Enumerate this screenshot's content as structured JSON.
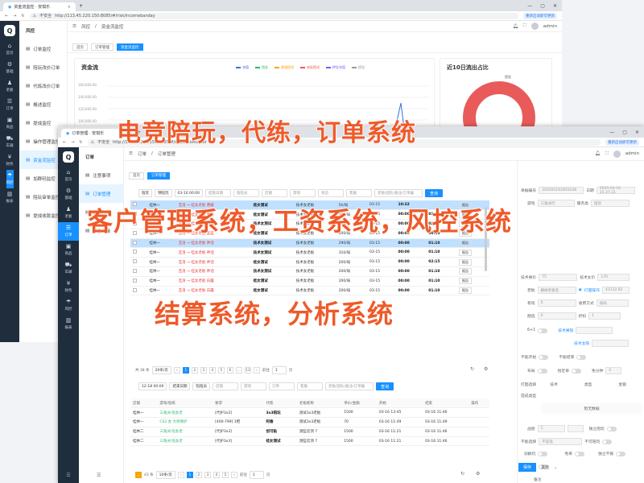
{
  "bg_window": {
    "tab_title": "资金流监控 · 安琪乐",
    "not_secure": "不安全",
    "url": "http://113.45.220.150:8085/#/risk/incomebanday",
    "update_label": "重新启动即可更新",
    "sidebar": [
      {
        "icon": "home-icon",
        "label": "首页"
      },
      {
        "icon": "base-icon",
        "label": "基础"
      },
      {
        "icon": "boss-icon",
        "label": "老板"
      },
      {
        "icon": "order-icon",
        "label": "订单"
      },
      {
        "icon": "shop-icon",
        "label": "商品"
      },
      {
        "icon": "car-icon",
        "label": "车辆"
      },
      {
        "icon": "finance-icon",
        "label": "财务"
      },
      {
        "icon": "risk-icon",
        "label": "风控"
      },
      {
        "icon": "report-icon",
        "label": "报表"
      }
    ],
    "submenu_title": "风控",
    "submenu": [
      "订单监控",
      "陪玩改价订单",
      "代练改价订单",
      "概述监控",
      "提成监控",
      "操作管理监控",
      "资金流监控",
      "加群码监控",
      "陪玩审单监控",
      "提成收款监控"
    ],
    "breadcrumb": [
      "风控",
      "资金流监控"
    ],
    "tags": [
      "首页",
      "订单管理",
      "资金流监控"
    ],
    "card1_title": "资金流",
    "legend": [
      "充值",
      "佣金",
      "客服提成",
      "老板提成",
      "押金充值",
      "提现"
    ],
    "card2_title": "近10日流出占比",
    "donut_label": "提现",
    "user": "admin",
    "y_axis": [
      "160,000.00",
      "140,000.00",
      "120,000.00",
      "100,000.00"
    ]
  },
  "fg_window": {
    "tab_title": "订单管理 · 安琪乐",
    "not_secure": "不安全",
    "url": "http://113.45.220.150:8085/#/ord/accomorder",
    "update_label": "重新启动即可更新",
    "sidebar": [
      {
        "icon": "home-icon",
        "label": "首页"
      },
      {
        "icon": "base-icon",
        "label": "基础"
      },
      {
        "icon": "boss-icon",
        "label": "老板"
      },
      {
        "icon": "order-icon",
        "label": "订单"
      },
      {
        "icon": "shop-icon",
        "label": "商品"
      },
      {
        "icon": "car-icon",
        "label": "车辆"
      },
      {
        "icon": "finance-icon",
        "label": "财务"
      },
      {
        "icon": "risk-icon",
        "label": "风控"
      },
      {
        "icon": "report-icon",
        "label": "报表"
      }
    ],
    "submenu_title": "订单",
    "submenu": [
      "注意事项",
      "订单管理",
      "订单",
      "报备记录"
    ],
    "breadcrumb": [
      "订单",
      "订单管理"
    ],
    "tags": [
      "首页",
      "订单管理"
    ],
    "user": "admin",
    "filters1": [
      "陪玩",
      "预陪玩",
      "03-10 00:00",
      "结束日期",
      "陪陪员",
      "店铺",
      "游戏",
      "状态",
      "客服",
      "老板/团队/备注/订单编",
      "查询"
    ],
    "table1_rows": [
      {
        "a": "桂林一",
        "b": "瓦洛 → 桂女老板 曹媛",
        "c": "桂女测试",
        "d": "技术女老板",
        "e": "5h/局",
        "f": "03-15",
        "g": "10:32",
        "h": "",
        "i": "报告",
        "sel": true
      },
      {
        "a": "桂林一",
        "b": "瓦洛 → 桂女老板 曹媛",
        "c": "桂女测试",
        "d": "技术女老板",
        "e": "310/局",
        "f": "03-15",
        "g": "00:00",
        "h": "01:10",
        "i": "报告",
        "sel": false
      },
      {
        "a": "桂林一",
        "b": "瓦洛 → 桂女老板 白露",
        "c": "技术女测试",
        "d": "技术女老板",
        "e": "200/局",
        "f": "03-15",
        "g": "00:00",
        "h": "02:15",
        "i": "报告",
        "sel": false
      },
      {
        "a": "桂林一",
        "b": "瓦洛 → 桂女老板 蓝蓝",
        "c": "桂女测试",
        "d": "技术女老板",
        "e": "200/局",
        "f": "03-15",
        "g": "00:00",
        "h": "00:10",
        "i": "报告",
        "sel": false
      },
      {
        "a": "桂林一",
        "b": "瓦洛 → 桂女老板 神话",
        "c": "技术女测试",
        "d": "技术女老板",
        "e": "290/局",
        "f": "03-15",
        "g": "00:00",
        "h": "01:10",
        "i": "报告",
        "sel": true
      },
      {
        "a": "桂林一",
        "b": "瓦洛 → 桂女老板 神话",
        "c": "技术女测试",
        "d": "技术女老板",
        "e": "310/局",
        "f": "03-15",
        "g": "00:00",
        "h": "01:10",
        "i": "报告",
        "sel": false
      },
      {
        "a": "桂林一",
        "b": "瓦洛 → 桂女老板 神话",
        "c": "桂女测试",
        "d": "技术女老板",
        "e": "200/局",
        "f": "03-15",
        "g": "00:00",
        "h": "02:15",
        "i": "报告",
        "sel": false
      },
      {
        "a": "桂林一",
        "b": "瓦洛 → 桂女老板 神话",
        "c": "技术女测试",
        "d": "技术女老板",
        "e": "200/局",
        "f": "03-15",
        "g": "00:00",
        "h": "01:10",
        "i": "报告",
        "sel": false
      },
      {
        "a": "桂林一",
        "b": "瓦洛 → 桂女老板 白露",
        "c": "桂女测试",
        "d": "技术女老板",
        "e": "200/局",
        "f": "03-15",
        "g": "00:00",
        "h": "01:10",
        "i": "报告",
        "sel": false
      },
      {
        "a": "桂林一",
        "b": "瓦洛 → 桂女老板 白露",
        "c": "桂女测试",
        "d": "技术女老板",
        "e": "200/局",
        "f": "03-15",
        "g": "00:00",
        "h": "01:10",
        "i": "报告",
        "sel": false
      }
    ],
    "pager1": {
      "total": "共 38 条",
      "size": "20条/页",
      "pages": [
        "1",
        "2",
        "3",
        "4",
        "5",
        "6",
        "...",
        "13"
      ],
      "goto_label": "前往",
      "goto": "1",
      "unit": "页"
    },
    "filters2": [
      "12-18 00:00",
      "结束日期",
      "陪陪员",
      "店铺",
      "游戏",
      "订单",
      "客服",
      "老板/团队/备注/订单编",
      "查询"
    ],
    "table2_head": [
      "店铺",
      "游戏/陪练",
      "要求",
      "代练",
      "老板昵称",
      "单价/金额",
      "开始",
      "结束",
      "操作"
    ],
    "table2_rows": [
      {
        "a": "桂林一",
        "b": "三角洲 陪女老",
        "c": "[代护3x3]",
        "d": "3x3陪玩",
        "e": "测试3x3老板",
        "f": "1500",
        "g": "03-16 13:45",
        "h": "03-16 11:46"
      },
      {
        "a": "桂林一",
        "b": "CS2 女 大师保护",
        "c": "[400-799] 1把",
        "d": "阿香",
        "e": "测试3x3老板",
        "f": "70",
        "g": "03-16 11:49",
        "h": "03-16 11:49"
      },
      {
        "a": "桂林二",
        "b": "三角洲 陪女老",
        "c": "[代护3x3]",
        "d": "创可贴",
        "e": "测些云顶 7",
        "f": "1500",
        "g": "03-16 11:21",
        "h": "03-16 11:46"
      },
      {
        "a": "桂林二",
        "b": "三角洲 陪女老",
        "c": "[代护3x3]",
        "d": "桂女测试",
        "e": "测些云顶 7",
        "f": "1500",
        "g": "03-16 11:21",
        "h": "03-16 11:46"
      }
    ],
    "pager2": {
      "total": "43 条",
      "size": "10条/页",
      "pages": [
        "1",
        "2",
        "3",
        "4",
        "5"
      ],
      "goto_label": "前往",
      "goto": "1",
      "unit": "页"
    },
    "form": {
      "order_no_label": "单据编号",
      "order_no": "20250316185S108",
      "date_label": "日期",
      "date": "2025-03-16 15:37:21",
      "game_label": "游戏",
      "game": "三角洲行",
      "service_label": "服务类",
      "service": "陪玩",
      "tech_price_label": "技术男价",
      "tech_price": "75",
      "tech_split_label": "技术女价",
      "tech_split": "170",
      "boss_label": "老板",
      "boss": "删掉老板名",
      "driver_label": "打图操作",
      "driver": "43132.92",
      "hours_label": "有钱",
      "hours": "0",
      "amount_label": "收费方式",
      "amount": "按局",
      "disc_label": "圈选",
      "disc": "0",
      "rate_label": "折扣",
      "rate": "1",
      "six_label": "6+1",
      "tech_person_label": "技术男陪",
      "tech_female_label": "技术女陪",
      "start_label": "不能开始",
      "end_label": "不能结束",
      "lock_label": "布局",
      "fixed_label": "指定单",
      "free_label": "免分钟",
      "free": "0",
      "group_label": "打图选择",
      "tech_label": "技术",
      "type_label": "类型",
      "amount_col": "金额",
      "note_label": "提成类型",
      "no_data": "暂无数据",
      "group2_label": "战绩",
      "group2": "1",
      "independent_label": "独立陪玩",
      "nopic_label": "不能选择",
      "nopic": "不是选",
      "noaccept_label": "不可陪玩",
      "add_label": "加群玩",
      "free2_label": "免单",
      "nosend_label": "独立不报",
      "problem_label": "问题订单",
      "remark_label": "备注",
      "save": "保存",
      "other": "其他"
    }
  },
  "overlay": {
    "line1": "电竞陪玩，代练，订单系统",
    "line2": "客户管理系统，工资系统，风控系统",
    "line3": "结算系统，分析系统"
  },
  "colors": {
    "accent": "#1890ff",
    "sidebar": "#1f2d3d",
    "overlay": "#ee5a2a",
    "donut": "#e95b5b"
  }
}
